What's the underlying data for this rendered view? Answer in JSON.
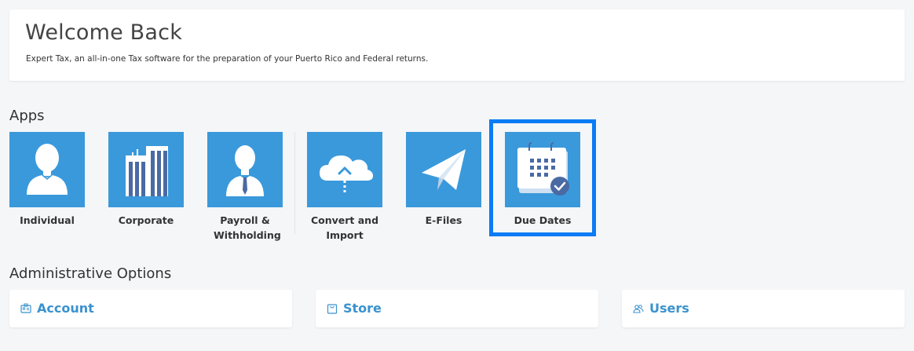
{
  "welcome": {
    "title": "Welcome Back",
    "subtitle": "Expert Tax, an all-in-one Tax software for the preparation of your Puerto Rico and Federal returns."
  },
  "apps": {
    "heading": "Apps",
    "items": [
      {
        "label": "Individual",
        "icon": "person-icon"
      },
      {
        "label": "Corporate",
        "icon": "buildings-icon"
      },
      {
        "label": "Payroll & Withholding",
        "icon": "person-tie-icon"
      },
      {
        "label": "Convert and Import",
        "icon": "cloud-upload-icon"
      },
      {
        "label": "E-Files",
        "icon": "paper-plane-icon"
      },
      {
        "label": "Due Dates",
        "icon": "calendar-check-icon"
      }
    ],
    "selected": "Due Dates"
  },
  "admin": {
    "heading": "Administrative Options",
    "items": [
      {
        "label": "Account",
        "icon": "id-card-icon"
      },
      {
        "label": "Store",
        "icon": "bag-icon"
      },
      {
        "label": "Users",
        "icon": "users-icon"
      }
    ]
  },
  "colors": {
    "tile": "#3a99db",
    "highlight": "#0a7cf5",
    "link": "#3a92cf",
    "background": "#f5f6f8"
  }
}
